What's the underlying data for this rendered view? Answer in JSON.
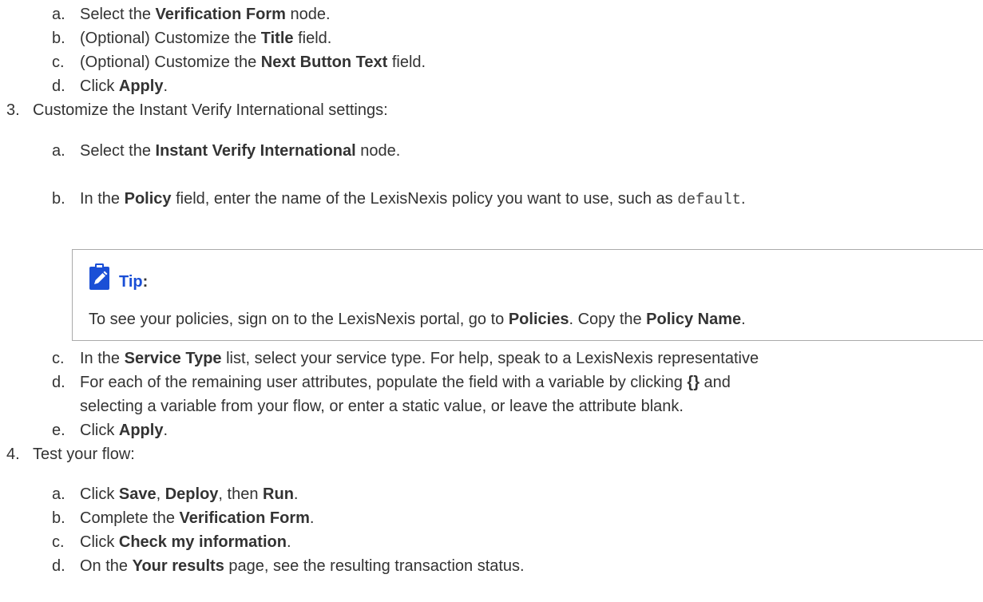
{
  "steps": {
    "s2": {
      "a": {
        "marker": "a.",
        "pre": "Select the ",
        "b1": "Verification Form",
        "post": " node."
      },
      "b": {
        "marker": "b.",
        "pre": "(Optional) Customize the ",
        "b1": "Title",
        "post": " field."
      },
      "c": {
        "marker": "c.",
        "pre": "(Optional) Customize the ",
        "b1": "Next Button Text",
        "post": " field."
      },
      "d": {
        "marker": "d.",
        "pre": "Click ",
        "b1": "Apply",
        "post": "."
      }
    },
    "s3": {
      "marker": "3.",
      "text": "Customize the Instant Verify International settings:",
      "a": {
        "marker": "a.",
        "pre": "Select the ",
        "b1": "Instant Verify International",
        "post": " node."
      },
      "b": {
        "marker": "b.",
        "pre": "In the ",
        "b1": "Policy",
        "mid": " field, enter the name of the LexisNexis policy you want to use, such as ",
        "code": "default",
        "post": "."
      },
      "tip": {
        "title": "Tip",
        "colon": ":",
        "pre": "To see your policies, sign on to the LexisNexis portal, go to ",
        "b1": "Policies",
        "mid": ". Copy the ",
        "b2": "Policy Name",
        "post": "."
      },
      "c": {
        "marker": "c.",
        "pre": "In the ",
        "b1": "Service Type",
        "post": " list, select your service type. For help, speak to a LexisNexis representative"
      },
      "d": {
        "marker": "d.",
        "line1_pre": "For each of the remaining user attributes, populate the field with a variable by clicking ",
        "b1": "{}",
        "line1_post": " and",
        "line2": "selecting a variable from your flow, or enter a static value, or leave the attribute blank."
      },
      "e": {
        "marker": "e.",
        "pre": "Click ",
        "b1": "Apply",
        "post": "."
      }
    },
    "s4": {
      "marker": "4.",
      "text": "Test your flow:",
      "a": {
        "marker": "a.",
        "pre": "Click ",
        "b1": "Save",
        "sep1": ", ",
        "b2": "Deploy",
        "sep2": ", then ",
        "b3": "Run",
        "post": "."
      },
      "b": {
        "marker": "b.",
        "pre": "Complete the ",
        "b1": "Verification Form",
        "post": "."
      },
      "c": {
        "marker": "c.",
        "pre": "Click ",
        "b1": "Check my information",
        "post": "."
      },
      "d": {
        "marker": "d.",
        "pre": "On the ",
        "b1": "Your results",
        "post": " page, see the resulting transaction status."
      }
    }
  },
  "icons": {
    "tip": "pencil-clipboard-icon",
    "accent": "#1a4fd6",
    "text_color": "#333333"
  }
}
